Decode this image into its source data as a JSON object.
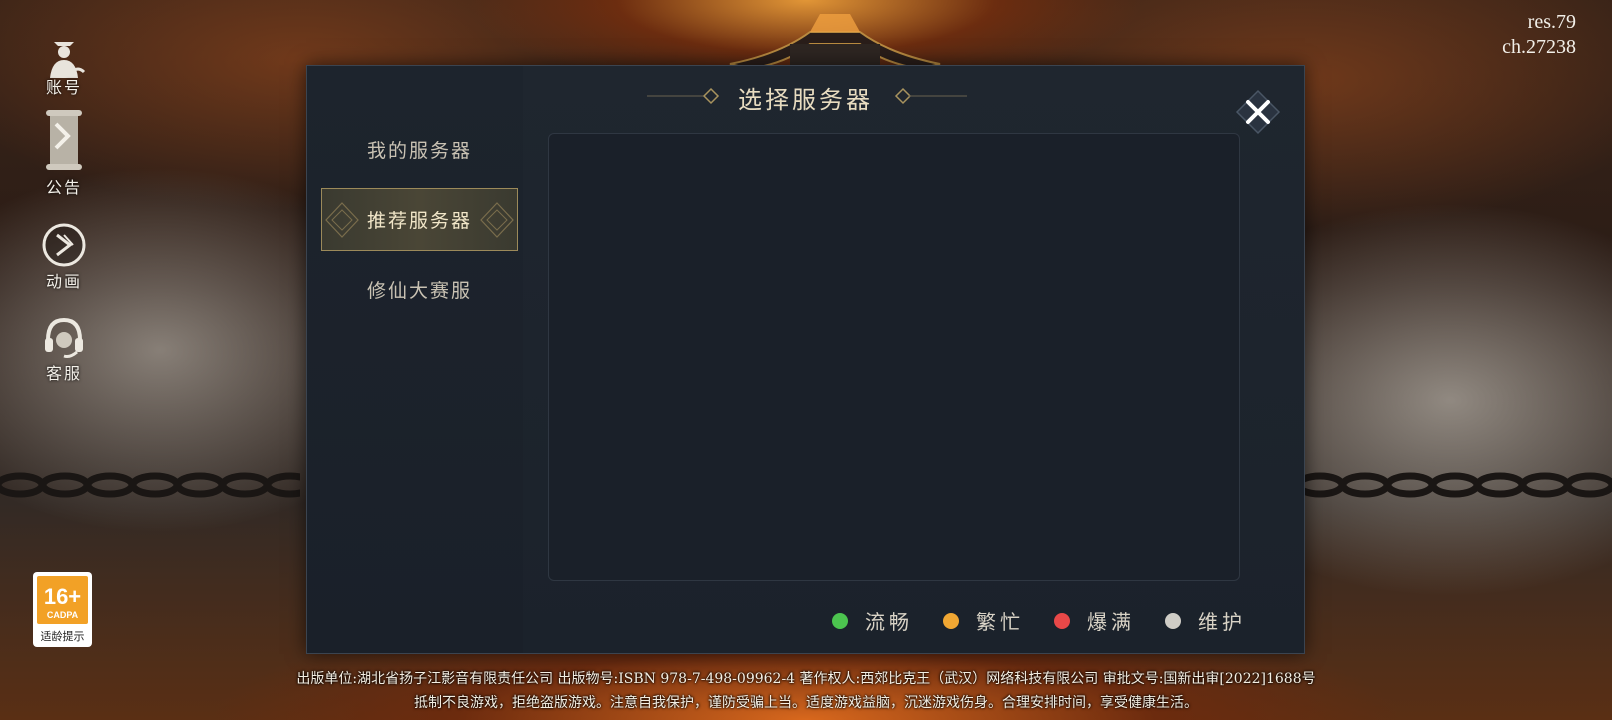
{
  "version": {
    "res": "res.79",
    "ch": "ch.27238"
  },
  "side_nav": [
    {
      "icon": "account-icon",
      "label": "账号"
    },
    {
      "icon": "announcement-scroll-icon",
      "label": "公告"
    },
    {
      "icon": "play-animation-icon",
      "label": "动画"
    },
    {
      "icon": "customer-service-headset-icon",
      "label": "客服"
    }
  ],
  "age_rating": {
    "age": "16+",
    "org": "CADPA",
    "hint": "适龄提示"
  },
  "dialog": {
    "title": "选择服务器",
    "tabs": [
      {
        "label": "我的服务器",
        "active": false
      },
      {
        "label": "推荐服务器",
        "active": true
      },
      {
        "label": "修仙大赛服",
        "active": false
      }
    ],
    "legend": [
      {
        "label": "流畅",
        "color": "#4cc44f"
      },
      {
        "label": "繁忙",
        "color": "#f0a733"
      },
      {
        "label": "爆满",
        "color": "#e84848"
      },
      {
        "label": "维护",
        "color": "#cfcdc6"
      }
    ]
  },
  "footer": {
    "line1": "出版单位:湖北省扬子江影音有限责任公司 出版物号:ISBN 978-7-498-09962-4 著作权人:西郊比克王（武汉）网络科技有限公司  审批文号:国新出审[2022]1688号",
    "line2": "抵制不良游戏，拒绝盗版游戏。注意自我保护，谨防受骗上当。适度游戏益脑，沉迷游戏伤身。合理安排时间，享受健康生活。"
  }
}
